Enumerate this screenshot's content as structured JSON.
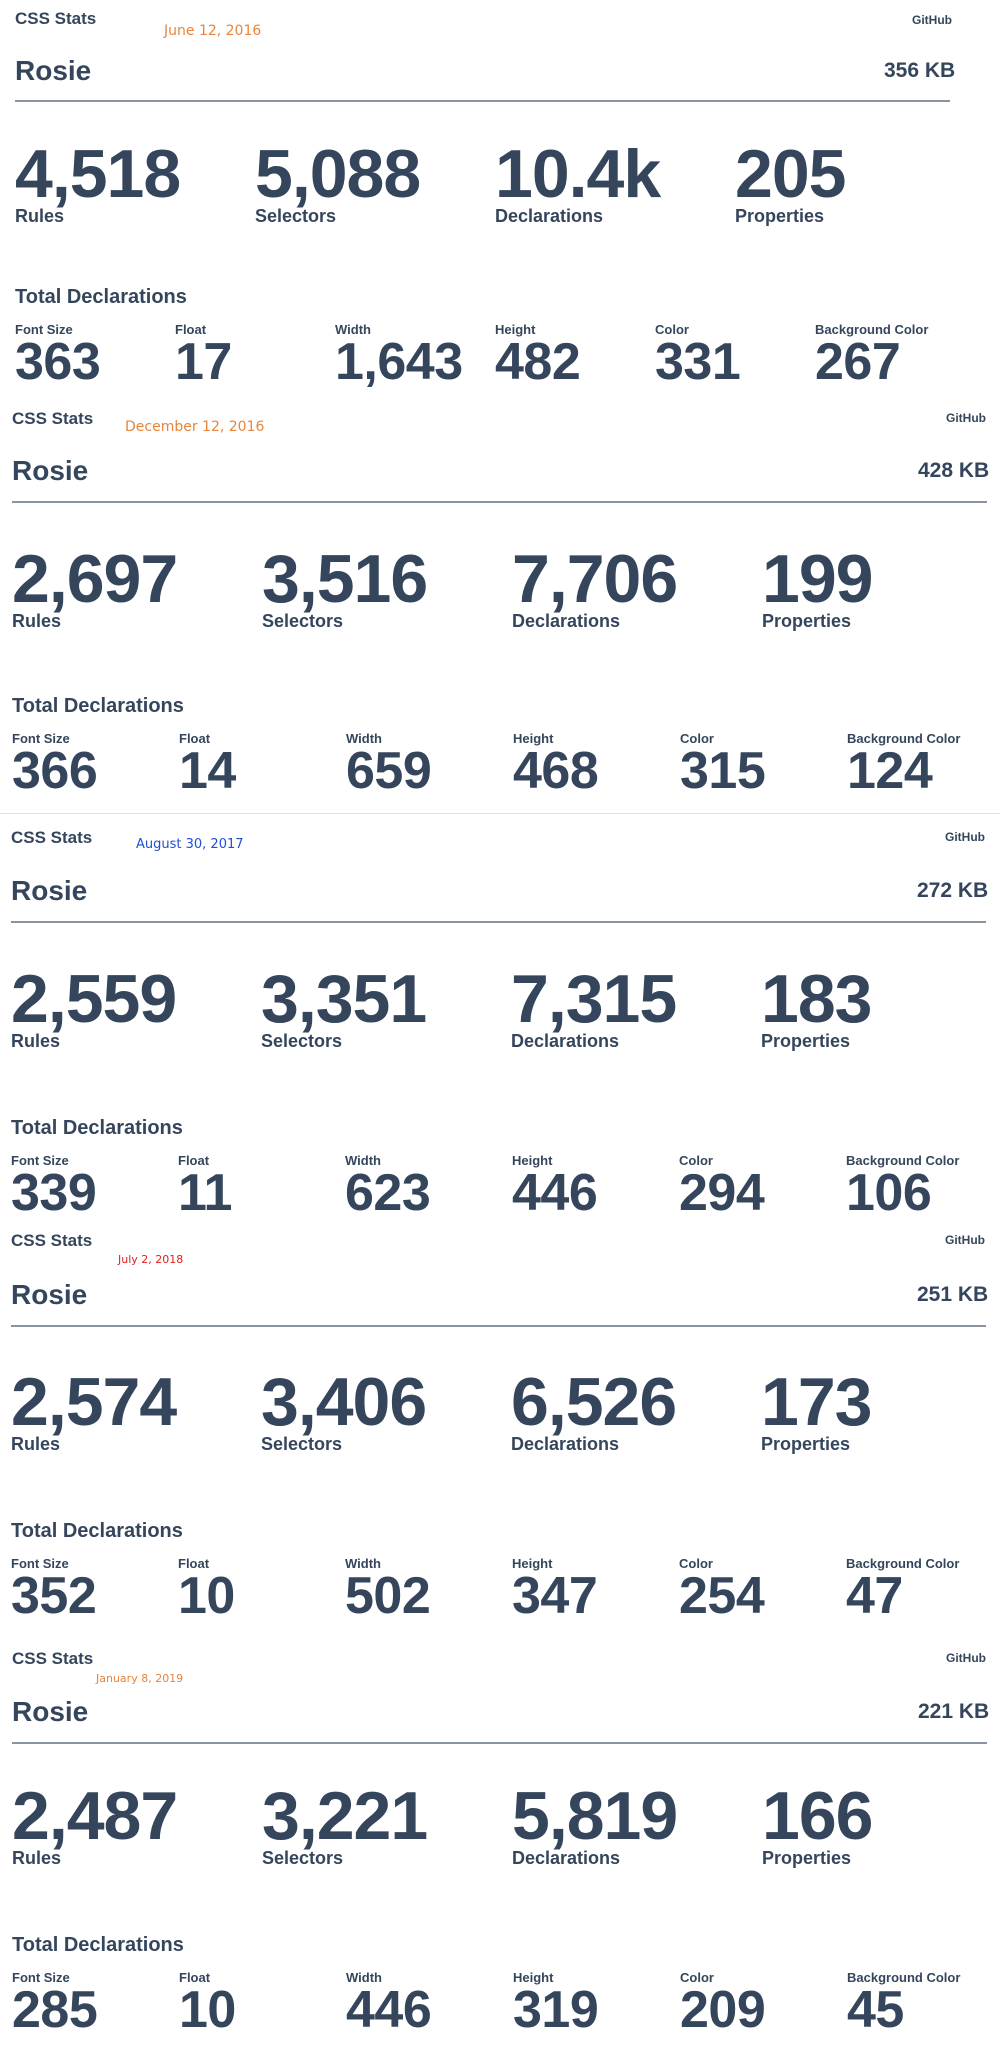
{
  "snapshots": [
    {
      "brand": "CSS Stats",
      "date": "June 12, 2016",
      "date_color": "#e8843c",
      "github": "GitHub",
      "site": "Rosie",
      "size": "356 KB",
      "totals": [
        {
          "value": "4,518",
          "label": "Rules"
        },
        {
          "value": "5,088",
          "label": "Selectors"
        },
        {
          "value": "10.4k",
          "label": "Declarations"
        },
        {
          "value": "205",
          "label": "Properties"
        }
      ],
      "total_declarations_heading": "Total Declarations",
      "properties": [
        {
          "label": "Font Size",
          "value": "363"
        },
        {
          "label": "Float",
          "value": "17"
        },
        {
          "label": "Width",
          "value": "1,643"
        },
        {
          "label": "Height",
          "value": "482"
        },
        {
          "label": "Color",
          "value": "331"
        },
        {
          "label": "Background Color",
          "value": "267"
        }
      ]
    },
    {
      "brand": "CSS Stats",
      "date": "December 12, 2016",
      "date_color": "#e8843c",
      "github": "GitHub",
      "site": "Rosie",
      "size": "428 KB",
      "totals": [
        {
          "value": "2,697",
          "label": "Rules"
        },
        {
          "value": "3,516",
          "label": "Selectors"
        },
        {
          "value": "7,706",
          "label": "Declarations"
        },
        {
          "value": "199",
          "label": "Properties"
        }
      ],
      "total_declarations_heading": "Total Declarations",
      "properties": [
        {
          "label": "Font Size",
          "value": "366"
        },
        {
          "label": "Float",
          "value": "14"
        },
        {
          "label": "Width",
          "value": "659"
        },
        {
          "label": "Height",
          "value": "468"
        },
        {
          "label": "Color",
          "value": "315"
        },
        {
          "label": "Background Color",
          "value": "124"
        }
      ]
    },
    {
      "brand": "CSS Stats",
      "date": "August 30, 2017",
      "date_color": "#1f4fd6",
      "github": "GitHub",
      "site": "Rosie",
      "size": "272 KB",
      "totals": [
        {
          "value": "2,559",
          "label": "Rules"
        },
        {
          "value": "3,351",
          "label": "Selectors"
        },
        {
          "value": "7,315",
          "label": "Declarations"
        },
        {
          "value": "183",
          "label": "Properties"
        }
      ],
      "total_declarations_heading": "Total Declarations",
      "properties": [
        {
          "label": "Font Size",
          "value": "339"
        },
        {
          "label": "Float",
          "value": "11"
        },
        {
          "label": "Width",
          "value": "623"
        },
        {
          "label": "Height",
          "value": "446"
        },
        {
          "label": "Color",
          "value": "294"
        },
        {
          "label": "Background Color",
          "value": "106"
        }
      ]
    },
    {
      "brand": "CSS Stats",
      "date": "July 2, 2018",
      "date_color": "#e02020",
      "github": "GitHub",
      "site": "Rosie",
      "size": "251 KB",
      "totals": [
        {
          "value": "2,574",
          "label": "Rules"
        },
        {
          "value": "3,406",
          "label": "Selectors"
        },
        {
          "value": "6,526",
          "label": "Declarations"
        },
        {
          "value": "173",
          "label": "Properties"
        }
      ],
      "total_declarations_heading": "Total Declarations",
      "properties": [
        {
          "label": "Font Size",
          "value": "352"
        },
        {
          "label": "Float",
          "value": "10"
        },
        {
          "label": "Width",
          "value": "502"
        },
        {
          "label": "Height",
          "value": "347"
        },
        {
          "label": "Color",
          "value": "254"
        },
        {
          "label": "Background Color",
          "value": "47"
        }
      ]
    },
    {
      "brand": "CSS Stats",
      "date": "January 8, 2019",
      "date_color": "#e8843c",
      "github": "GitHub",
      "site": "Rosie",
      "size": "221 KB",
      "totals": [
        {
          "value": "2,487",
          "label": "Rules"
        },
        {
          "value": "3,221",
          "label": "Selectors"
        },
        {
          "value": "5,819",
          "label": "Declarations"
        },
        {
          "value": "166",
          "label": "Properties"
        }
      ],
      "total_declarations_heading": "Total Declarations",
      "properties": [
        {
          "label": "Font Size",
          "value": "285"
        },
        {
          "label": "Float",
          "value": "10"
        },
        {
          "label": "Width",
          "value": "446"
        },
        {
          "label": "Height",
          "value": "319"
        },
        {
          "label": "Color",
          "value": "209"
        },
        {
          "label": "Background Color",
          "value": "45"
        }
      ]
    }
  ]
}
